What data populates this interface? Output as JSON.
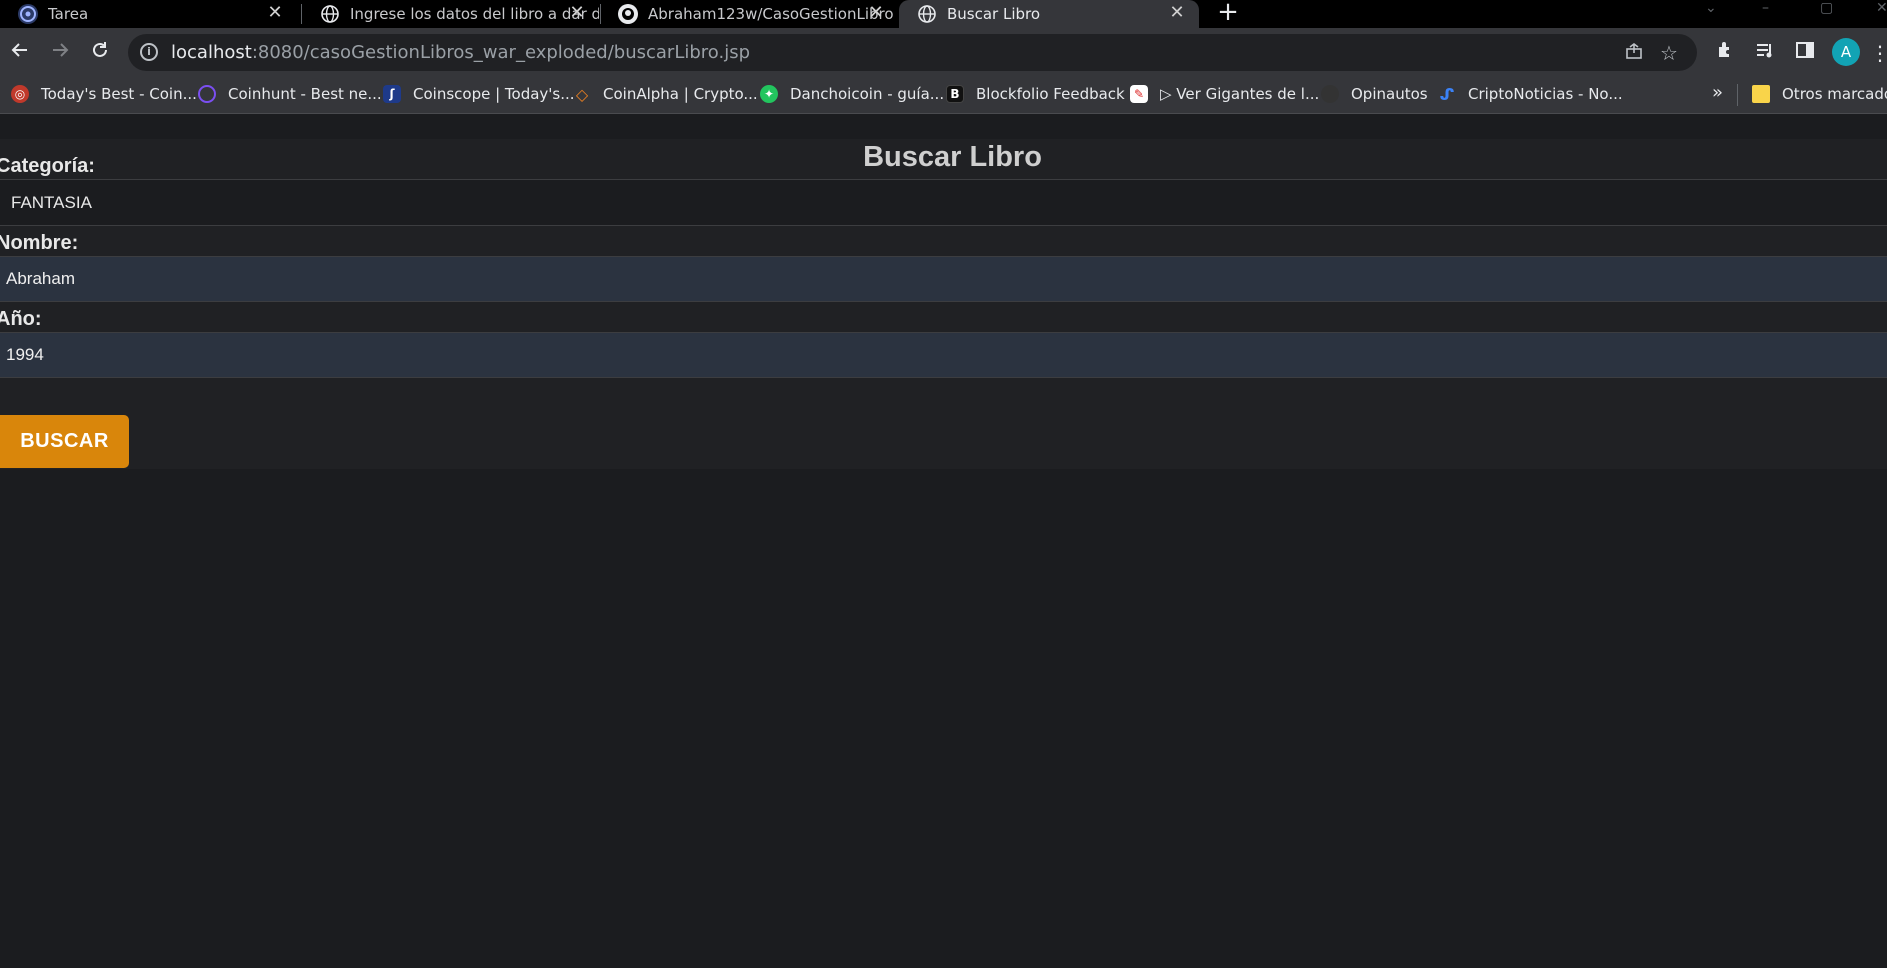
{
  "browser": {
    "tabs": [
      {
        "label": "Tarea",
        "icon": "tarea-favicon",
        "active": false
      },
      {
        "label": "Ingrese los datos del libro a dar d",
        "icon": "globe-icon",
        "active": false
      },
      {
        "label": "Abraham123w/CasoGestionLibro",
        "icon": "github-icon",
        "active": false
      },
      {
        "label": "Buscar Libro",
        "icon": "globe-icon",
        "active": true
      }
    ],
    "close_glyph": "✕",
    "new_tab_glyph": "+",
    "url_host": "localhost",
    "url_rest": ":8080/casoGestionLibros_war_exploded/buscarLibro.jsp",
    "profile_initial": "A"
  },
  "bookmarks": {
    "items": [
      {
        "label": "Today's Best - Coin...",
        "icon": "coin-icon",
        "color": "#c0392b"
      },
      {
        "label": "Coinhunt - Best ne...",
        "icon": "coinhunt-icon",
        "color": "#7b4ff2"
      },
      {
        "label": "Coinscope | Today's...",
        "icon": "coinscope-icon",
        "color": "#1e3a8a"
      },
      {
        "label": "CoinAlpha | Crypto...",
        "icon": "coinalpha-icon",
        "color": "#e67e22"
      },
      {
        "label": "Danchoicoin - guía...",
        "icon": "danchoicoin-icon",
        "color": "#22c55e"
      },
      {
        "label": "Blockfolio Feedback",
        "icon": "blockfolio-icon",
        "color": "#111111"
      },
      {
        "label": "▷ Ver Gigantes de l...",
        "icon": "gigantes-icon",
        "color": "#dc2626"
      },
      {
        "label": "Opinautos",
        "icon": "opinautos-icon",
        "color": "#333333"
      },
      {
        "label": "CriptoNoticias - No...",
        "icon": "criptonoticias-icon",
        "color": "#3b82f6"
      }
    ],
    "more_glyph": "»",
    "other_label": "Otros marcadores"
  },
  "page": {
    "title": "Buscar Libro",
    "categoria_label": "Categoría:",
    "categoria_value": "FANTASIA",
    "nombre_label": "Nombre:",
    "nombre_value": "Abraham",
    "anio_label": "Año:",
    "anio_value": "1994",
    "buscar_label": "BUSCAR",
    "accent_color": "#d9860b"
  }
}
